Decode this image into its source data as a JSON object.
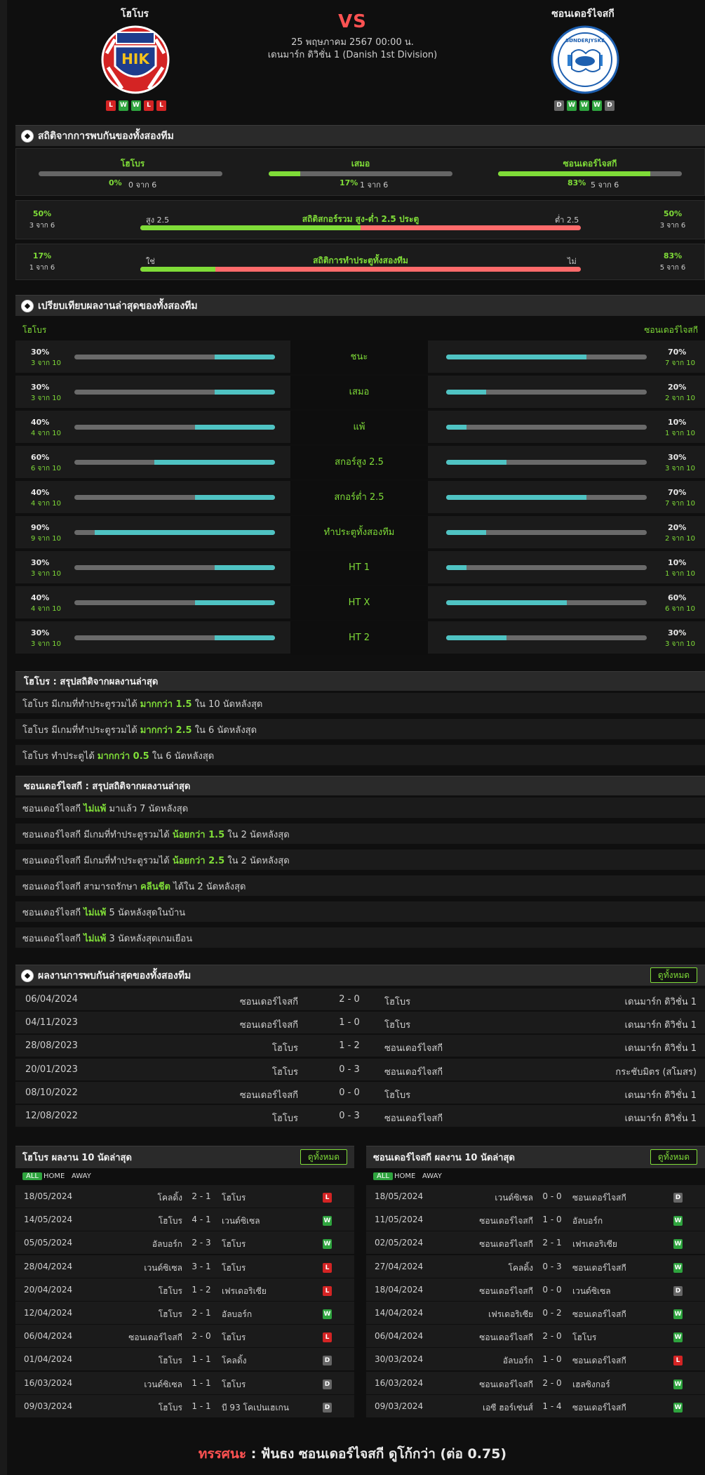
{
  "header": {
    "home_team": "โฮโบร",
    "away_team": "ซอนเดอร์ไจสกี",
    "vs": "VS",
    "date": "25 พฤษภาคม 2567 00:00 น.",
    "league": "เดนมาร์ก ดิวิชั่น 1 (Danish 1st Division)",
    "home_form": [
      "L",
      "W",
      "W",
      "L",
      "L"
    ],
    "away_form": [
      "D",
      "W",
      "W",
      "W",
      "D"
    ],
    "home_logo_text": "HIK",
    "away_logo_text": "SØNDERJYSKE"
  },
  "h2h_stats": {
    "title": "สถิติจากการพบกันของทั้งสองทีม",
    "home": {
      "label": "โฮโบร",
      "pct": "0%",
      "sub": "0 จาก 6",
      "fill": 0
    },
    "draw": {
      "label": "เสมอ",
      "pct": "17%",
      "sub": "1 จาก 6",
      "fill": 17
    },
    "away": {
      "label": "ซอนเดอร์ไจสกี",
      "pct": "83%",
      "sub": "5 จาก 6",
      "fill": 83
    },
    "ou": {
      "left_pct": "50%",
      "left_sub": "3 จาก 6",
      "left_label": "สูง 2.5",
      "title": "สถิติสกอร์รวม สูง-ต่ำ 2.5 ประตู",
      "right_label": "ต่ำ 2.5",
      "right_pct": "50%",
      "right_sub": "3 จาก 6",
      "fill": 50
    },
    "btts": {
      "left_pct": "17%",
      "left_sub": "1 จาก 6",
      "left_label": "ใช่",
      "title": "สถิติการทำประตูทั้งสองทีม",
      "right_label": "ไม่",
      "right_pct": "83%",
      "right_sub": "5 จาก 6",
      "fill": 17
    }
  },
  "compare": {
    "title": "เปรียบเทียบผลงานล่าสุดของทั้งสองทีม",
    "home": "โฮโบร",
    "away": "ซอนเดอร์ไจสกี",
    "rows": [
      {
        "label": "ชนะ",
        "hp": "30%",
        "hs": "3 จาก 10",
        "hv": 30,
        "ap": "70%",
        "as": "7 จาก 10",
        "av": 70
      },
      {
        "label": "เสมอ",
        "hp": "30%",
        "hs": "3 จาก 10",
        "hv": 30,
        "ap": "20%",
        "as": "2 จาก 10",
        "av": 20
      },
      {
        "label": "แพ้",
        "hp": "40%",
        "hs": "4 จาก 10",
        "hv": 40,
        "ap": "10%",
        "as": "1 จาก 10",
        "av": 10
      },
      {
        "label": "สกอร์สูง 2.5",
        "hp": "60%",
        "hs": "6 จาก 10",
        "hv": 60,
        "ap": "30%",
        "as": "3 จาก 10",
        "av": 30
      },
      {
        "label": "สกอร์ต่ำ 2.5",
        "hp": "40%",
        "hs": "4 จาก 10",
        "hv": 40,
        "ap": "70%",
        "as": "7 จาก 10",
        "av": 70
      },
      {
        "label": "ทำประตูทั้งสองทีม",
        "hp": "90%",
        "hs": "9 จาก 10",
        "hv": 90,
        "ap": "20%",
        "as": "2 จาก 10",
        "av": 20
      },
      {
        "label": "HT 1",
        "hp": "30%",
        "hs": "3 จาก 10",
        "hv": 30,
        "ap": "10%",
        "as": "1 จาก 10",
        "av": 10
      },
      {
        "label": "HT X",
        "hp": "40%",
        "hs": "4 จาก 10",
        "hv": 40,
        "ap": "60%",
        "as": "6 จาก 10",
        "av": 60
      },
      {
        "label": "HT 2",
        "hp": "30%",
        "hs": "3 จาก 10",
        "hv": 30,
        "ap": "30%",
        "as": "3 จาก 10",
        "av": 30
      }
    ]
  },
  "home_summary": {
    "title": "โฮโบร : สรุปสถิติจากผลงานล่าสุด",
    "rows": [
      {
        "a": "โฮโบร  มีเกมที่ทำประตูรวมได้ ",
        "b": "มากกว่า 1.5",
        "c": " ใน 10 นัดหลังสุด"
      },
      {
        "a": "โฮโบร  มีเกมที่ทำประตูรวมได้ ",
        "b": "มากกว่า 2.5",
        "c": " ใน 6 นัดหลังสุด"
      },
      {
        "a": "โฮโบร  ทำประตูได้ ",
        "b": "มากกว่า 0.5",
        "c": " ใน 6 นัดหลังสุด"
      }
    ]
  },
  "away_summary": {
    "title": "ซอนเดอร์ไจสกี : สรุปสถิติจากผลงานล่าสุด",
    "rows": [
      {
        "a": "ซอนเดอร์ไจสกี ",
        "b": "ไม่แพ้",
        "c": " มาแล้ว 7 นัดหลังสุด"
      },
      {
        "a": "ซอนเดอร์ไจสกี  มีเกมที่ทำประตูรวมได้ ",
        "b": "น้อยกว่า 1.5",
        "c": " ใน 2 นัดหลังสุด"
      },
      {
        "a": "ซอนเดอร์ไจสกี  มีเกมที่ทำประตูรวมได้ ",
        "b": "น้อยกว่า 2.5",
        "c": " ใน 2 นัดหลังสุด"
      },
      {
        "a": "ซอนเดอร์ไจสกี  สามารถรักษา ",
        "b": "คลีนชีต",
        "c": " ได้ใน 2 นัดหลังสุด"
      },
      {
        "a": "ซอนเดอร์ไจสกี ",
        "b": "ไม่แพ้",
        "c": "  5  นัดหลังสุดในบ้าน"
      },
      {
        "a": "ซอนเดอร์ไจสกี ",
        "b": "ไม่แพ้",
        "c": "  3  นัดหลังสุดเกมเยือน"
      }
    ]
  },
  "h2h": {
    "title": "ผลงานการพบกันล่าสุดของทั้งสองทีม",
    "all_btn": "ดูทั้งหมด",
    "rows": [
      {
        "date": "06/04/2024",
        "home": "ซอนเดอร์ไจสกี",
        "score": "2 - 0",
        "away": "โฮโบร",
        "league": "เดนมาร์ก ดิวิชั่น 1"
      },
      {
        "date": "04/11/2023",
        "home": "ซอนเดอร์ไจสกี",
        "score": "1 - 0",
        "away": "โฮโบร",
        "league": "เดนมาร์ก ดิวิชั่น 1"
      },
      {
        "date": "28/08/2023",
        "home": "โฮโบร",
        "score": "1 - 2",
        "away": "ซอนเดอร์ไจสกี",
        "league": "เดนมาร์ก ดิวิชั่น 1"
      },
      {
        "date": "20/01/2023",
        "home": "โฮโบร",
        "score": "0 - 3",
        "away": "ซอนเดอร์ไจสกี",
        "league": "กระชับมิตร (สโมสร)"
      },
      {
        "date": "08/10/2022",
        "home": "ซอนเดอร์ไจสกี",
        "score": "0 - 0",
        "away": "โฮโบร",
        "league": "เดนมาร์ก ดิวิชั่น 1"
      },
      {
        "date": "12/08/2022",
        "home": "โฮโบร",
        "score": "0 - 3",
        "away": "ซอนเดอร์ไจสกี",
        "league": "เดนมาร์ก ดิวิชั่น 1"
      }
    ]
  },
  "home_last10": {
    "title": "โฮโบร ผลงาน 10 นัดล่าสุด",
    "all_btn": "ดูทั้งหมด",
    "filters": [
      "ALL",
      "HOME",
      "AWAY"
    ],
    "rows": [
      {
        "date": "18/05/2024",
        "home": "โคลดิ้ง",
        "score": "2 - 1",
        "away": "โฮโบร",
        "res": "L"
      },
      {
        "date": "14/05/2024",
        "home": "โฮโบร",
        "score": "4 - 1",
        "away": "เวนด์ซิเซล",
        "res": "W"
      },
      {
        "date": "05/05/2024",
        "home": "อัลบอร์ก",
        "score": "2 - 3",
        "away": "โฮโบร",
        "res": "W"
      },
      {
        "date": "28/04/2024",
        "home": "เวนด์ซิเซล",
        "score": "3 - 1",
        "away": "โฮโบร",
        "res": "L"
      },
      {
        "date": "20/04/2024",
        "home": "โฮโบร",
        "score": "1 - 2",
        "away": "เฟรเดอริเซีย",
        "res": "L"
      },
      {
        "date": "12/04/2024",
        "home": "โฮโบร",
        "score": "2 - 1",
        "away": "อัลบอร์ก",
        "res": "W"
      },
      {
        "date": "06/04/2024",
        "home": "ซอนเดอร์ไจสกี",
        "score": "2 - 0",
        "away": "โฮโบร",
        "res": "L"
      },
      {
        "date": "01/04/2024",
        "home": "โฮโบร",
        "score": "1 - 1",
        "away": "โคลดิ้ง",
        "res": "D"
      },
      {
        "date": "16/03/2024",
        "home": "เวนด์ซิเซล",
        "score": "1 - 1",
        "away": "โฮโบร",
        "res": "D"
      },
      {
        "date": "09/03/2024",
        "home": "โฮโบร",
        "score": "1 - 1",
        "away": "บี 93 โคเปนเฮเกน",
        "res": "D"
      }
    ]
  },
  "away_last10": {
    "title": "ซอนเดอร์ไจสกี ผลงาน 10 นัดล่าสุด",
    "all_btn": "ดูทั้งหมด",
    "filters": [
      "ALL",
      "HOME",
      "AWAY"
    ],
    "rows": [
      {
        "date": "18/05/2024",
        "home": "เวนด์ซิเซล",
        "score": "0 - 0",
        "away": "ซอนเดอร์ไจสกี",
        "res": "D"
      },
      {
        "date": "11/05/2024",
        "home": "ซอนเดอร์ไจสกี",
        "score": "1 - 0",
        "away": "อัลบอร์ก",
        "res": "W"
      },
      {
        "date": "02/05/2024",
        "home": "ซอนเดอร์ไจสกี",
        "score": "2 - 1",
        "away": "เฟรเดอริเซีย",
        "res": "W"
      },
      {
        "date": "27/04/2024",
        "home": "โคลดิ้ง",
        "score": "0 - 3",
        "away": "ซอนเดอร์ไจสกี",
        "res": "W"
      },
      {
        "date": "18/04/2024",
        "home": "ซอนเดอร์ไจสกี",
        "score": "0 - 0",
        "away": "เวนด์ซิเซล",
        "res": "D"
      },
      {
        "date": "14/04/2024",
        "home": "เฟรเดอริเซีย",
        "score": "0 - 2",
        "away": "ซอนเดอร์ไจสกี",
        "res": "W"
      },
      {
        "date": "06/04/2024",
        "home": "ซอนเดอร์ไจสกี",
        "score": "2 - 0",
        "away": "โฮโบร",
        "res": "W"
      },
      {
        "date": "30/03/2024",
        "home": "อัลบอร์ก",
        "score": "1 - 0",
        "away": "ซอนเดอร์ไจสกี",
        "res": "L"
      },
      {
        "date": "16/03/2024",
        "home": "ซอนเดอร์ไจสกี",
        "score": "2 - 0",
        "away": "เฮลซิงกอร์",
        "res": "W"
      },
      {
        "date": "09/03/2024",
        "home": "เอซี ฮอร์เซ่นส์",
        "score": "1 - 4",
        "away": "ซอนเดอร์ไจสกี",
        "res": "W"
      }
    ]
  },
  "prediction": {
    "label": "ทรรศนะ",
    "sep": " : ",
    "text": "ฟันธง ซอนเดอร์ไจสกี ดูโก้กว่า (ต่อ 0.75)"
  },
  "colors": {
    "accent": "#7fdc38",
    "loss": "#ff5252",
    "teal": "#4fc3c3",
    "bg": "#0f0f0f"
  }
}
